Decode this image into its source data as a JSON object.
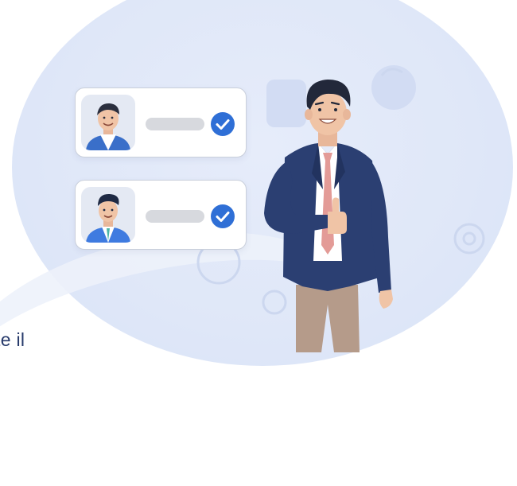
{
  "colors": {
    "accent": "#2f6fd6",
    "navy_jacket": "#2b3f72",
    "tie": "#e39b97",
    "trousers": "#b59b8a",
    "background_oval": "#dfe7f8"
  },
  "icons": {
    "check": "check-circle-icon",
    "avatar_1": "man-avatar-icon",
    "avatar_2": "man-avatar-icon"
  },
  "cut_text": "te il"
}
